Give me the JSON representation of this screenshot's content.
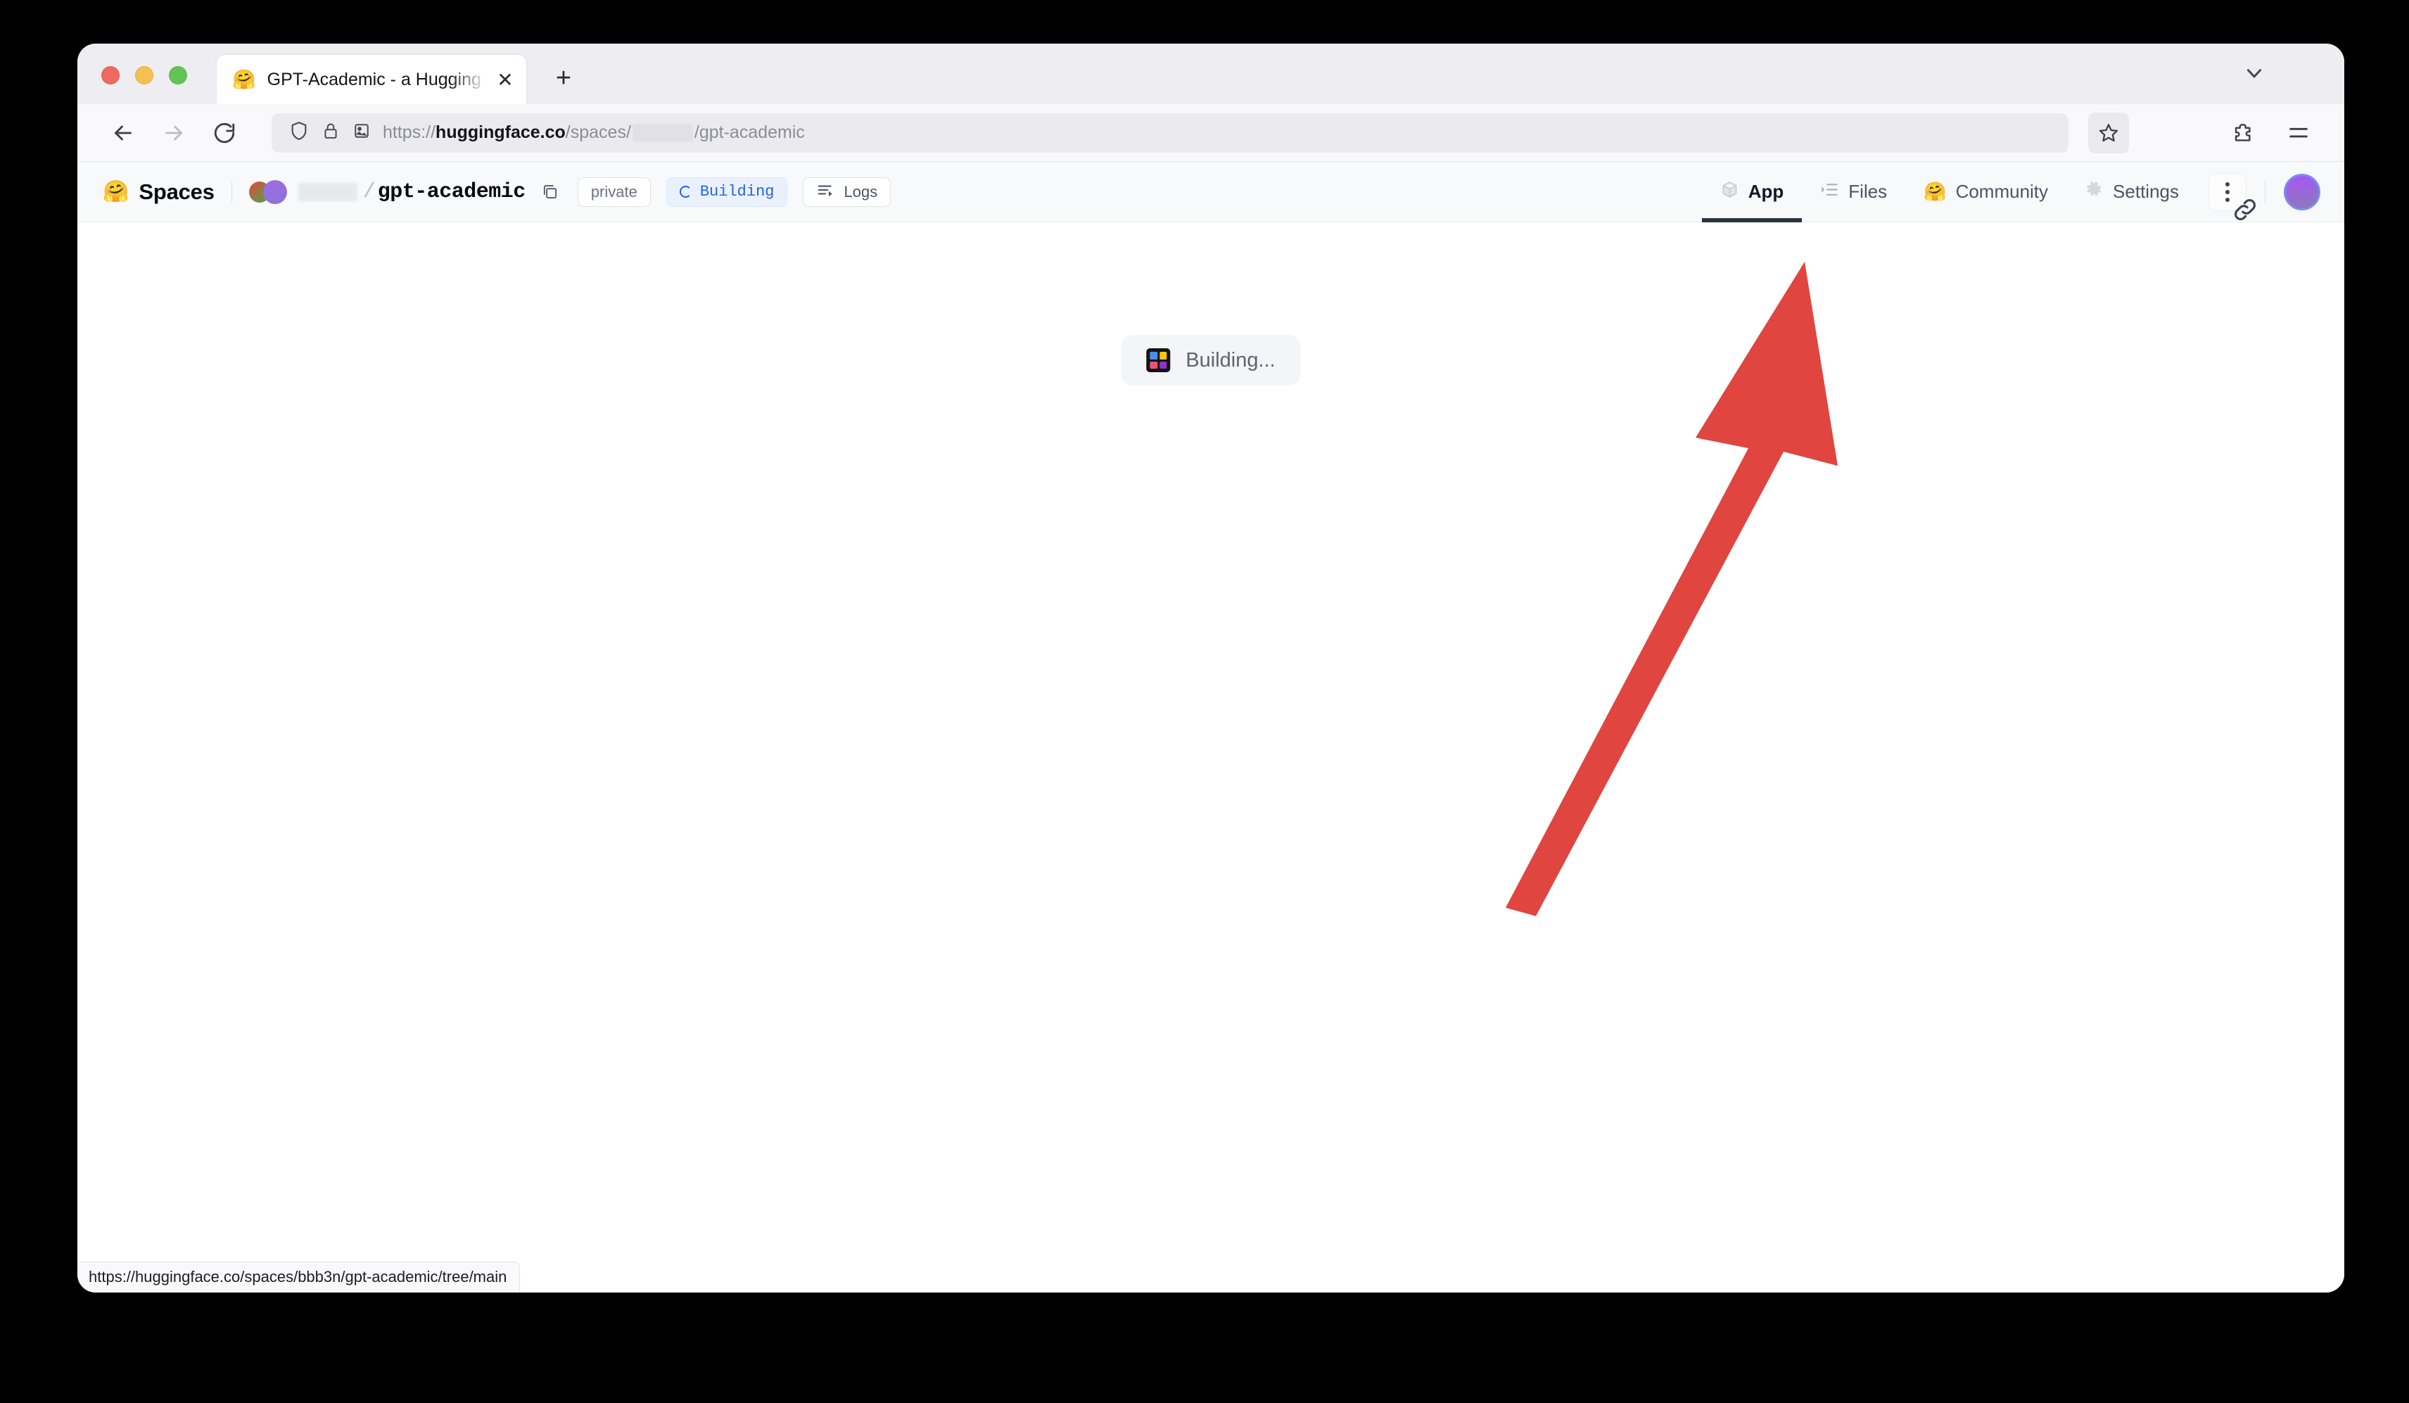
{
  "browser": {
    "tab": {
      "favicon": "hugging-face-emoji",
      "favicon_glyph": "🤗",
      "title": "GPT-Academic - a Hugging Face",
      "close_label": "✕"
    },
    "new_tab_label": "+",
    "toolbar": {
      "back_label": "Back",
      "forward_label": "Forward",
      "reload_label": "Reload",
      "url_scheme": "https://",
      "url_host": "huggingface.co",
      "url_path_pre": "/spaces/",
      "url_path_post": "/gpt-academic",
      "url_full": "https://huggingface.co/spaces/████/gpt-academic",
      "bookmark_label": "Bookmark this page",
      "extensions_label": "Extensions",
      "menu_label": "Open application menu"
    },
    "status_bar_url": "https://huggingface.co/spaces/bbb3n/gpt-academic/tree/main"
  },
  "hf_header": {
    "spaces_emoji": "🤗",
    "spaces_wordmark": "Spaces",
    "owner": "",
    "slash": "/",
    "repo_name": "gpt-academic",
    "copy_label": "Copy repository name",
    "badges": [
      {
        "label": "private",
        "name": "visibility-badge"
      },
      {
        "label": "Building",
        "name": "build-status-badge"
      },
      {
        "label": "Logs",
        "name": "logs-button"
      }
    ],
    "nav": [
      {
        "label": "App",
        "icon": "cube-icon",
        "active": true
      },
      {
        "label": "Files",
        "icon": "files-icon",
        "active": false
      },
      {
        "label": "Community",
        "icon": "hugging-face-emoji",
        "emoji": "🤗",
        "active": false
      },
      {
        "label": "Settings",
        "icon": "gear-icon",
        "active": false
      }
    ],
    "kebab_label": "More options",
    "avatar_label": "User profile"
  },
  "main": {
    "status_pill": {
      "icon": "gradio-logo-icon",
      "label": "Building..."
    }
  },
  "annotation": {
    "arrow_color": "#e0453f",
    "points_to": "Files"
  },
  "colors": {
    "accent_blue": "#2563eb",
    "nav_active": "#2b3440",
    "arrow_red": "#e0453f",
    "gradio_yellow": "#f5c518",
    "gradio_blue": "#4a90e2",
    "gradio_pink": "#e8527a",
    "gradio_purple": "#8b35c9"
  }
}
